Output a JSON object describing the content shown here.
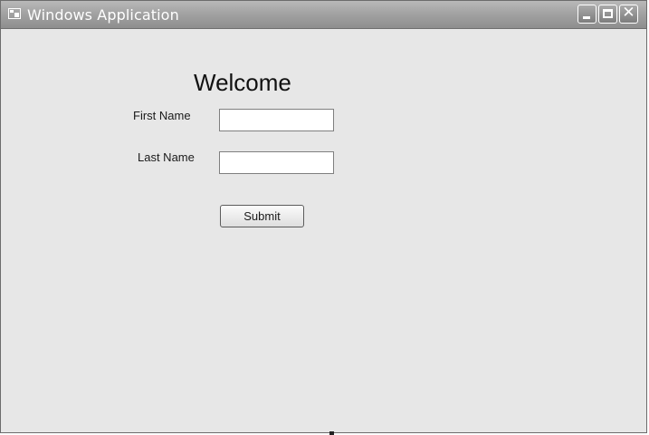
{
  "window": {
    "title": "Windows Application",
    "title_bar_color": "#a3a3a3",
    "client_color": "#e7e7e7",
    "controls": {
      "minimize_icon": "minimize-icon",
      "maximize_icon": "maximize-icon",
      "close_icon": "close-icon",
      "close_glyph": "✕"
    }
  },
  "form": {
    "heading": "Welcome",
    "first_name": {
      "label": "First Name",
      "value": ""
    },
    "last_name": {
      "label": "Last Name",
      "value": ""
    },
    "submit_label": "Submit"
  }
}
